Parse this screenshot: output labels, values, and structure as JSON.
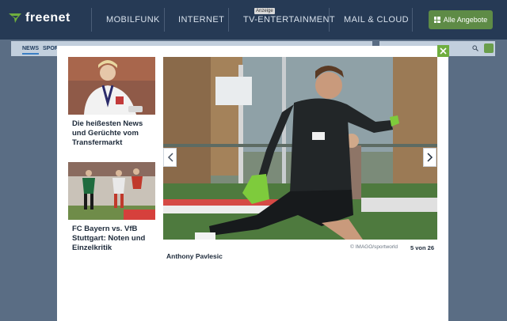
{
  "header": {
    "logo_text": "freenet",
    "nav": [
      {
        "label": "MOBILFUNK"
      },
      {
        "label": "INTERNET"
      },
      {
        "label": "TV-ENTERTAINMENT",
        "badge": "Anzeige"
      },
      {
        "label": "MAIL & CLOUD"
      }
    ],
    "offers_button": "Alle Angebote",
    "accent_color": "#5e8b46",
    "bg_color": "#263a55"
  },
  "subnav": {
    "items": [
      "NEWS",
      "SPOR"
    ],
    "active": "NEWS"
  },
  "gallery": {
    "close_icon": "close-icon",
    "related": [
      {
        "title": "Die heißesten News und Gerüchte vom Transfermarkt"
      },
      {
        "title": "FC Bayern vs. VfB Stuttgart: Noten und Einzelkritik"
      }
    ],
    "photo_credit": "© IMAGO/sportworld",
    "counter": "5 von 26",
    "caption": "Anthony Pavlesic",
    "prev_icon": "chevron-left-icon",
    "next_icon": "chevron-right-icon"
  }
}
